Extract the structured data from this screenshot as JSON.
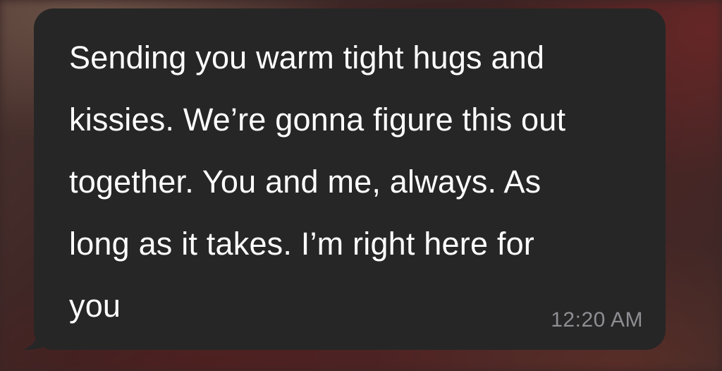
{
  "message": {
    "text": "Sending you warm tight hugs and\nkissies. We’re gonna figure this out\ntogether. You and me, always. As\nlong as it takes. I’m right here for\nyou",
    "timestamp": "12:20 AM"
  },
  "colors": {
    "bubble": "#262626",
    "text": "#ffffff",
    "timestamp": "#8e8e93"
  }
}
